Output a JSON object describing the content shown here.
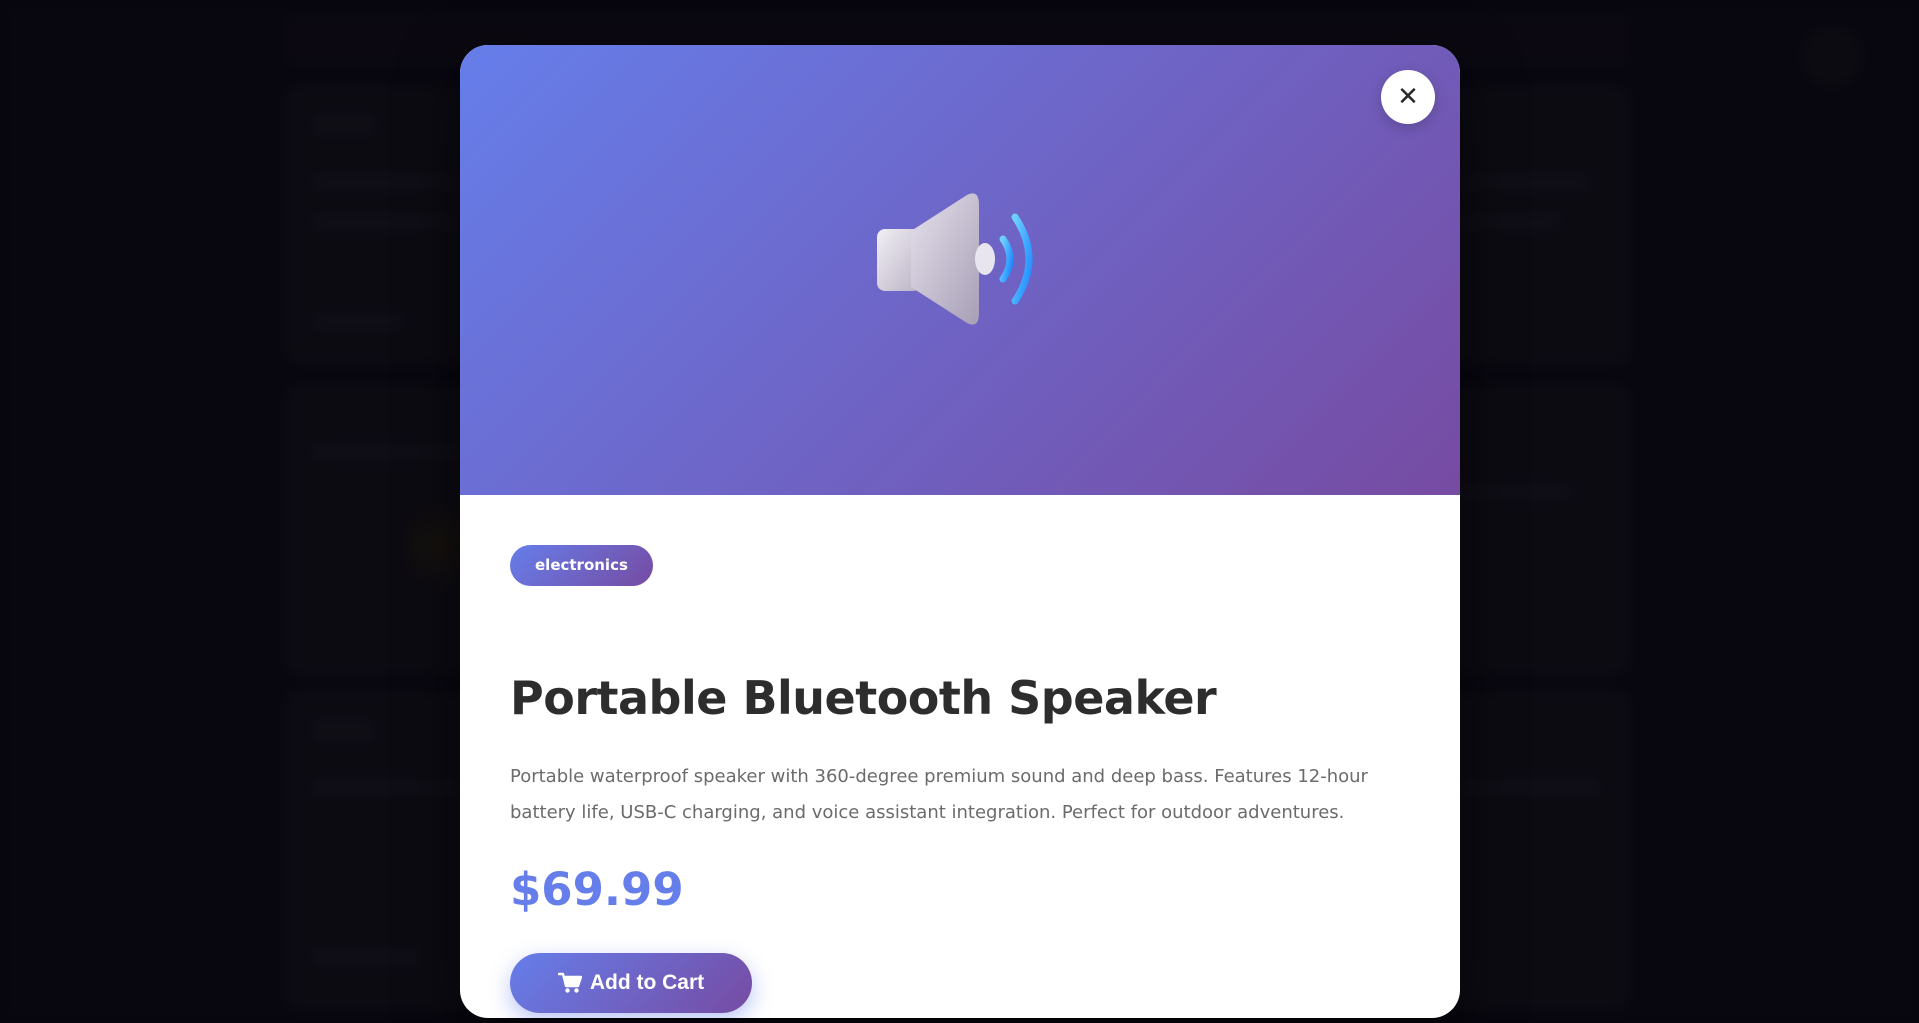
{
  "modal": {
    "close_symbol": "✕",
    "hero_icon": "speaker-with-sound-waves-icon",
    "category": "electronics",
    "title": "Portable Bluetooth Speaker",
    "description": "Portable waterproof speaker with 360-degree premium sound and deep bass. Features 12-hour battery life, USB-C charging, and voice assistant integration. Perfect for outdoor adventures.",
    "price": "$69.99",
    "add_to_cart_label": "Add to Cart",
    "add_to_cart_icon": "shopping-cart-icon"
  },
  "colors": {
    "gradient_start": "#667eea",
    "gradient_end": "#764ba2",
    "price": "#667eea",
    "title": "#2d2d2d",
    "description": "#6b6b6b",
    "overlay": "#0a0810"
  }
}
